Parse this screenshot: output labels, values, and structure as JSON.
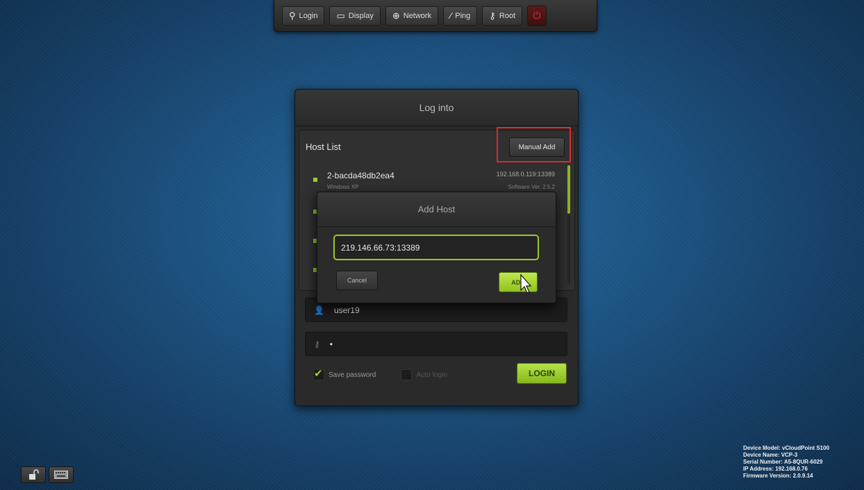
{
  "toolbar": {
    "login_label": "Login",
    "display_label": "Display",
    "network_label": "Network",
    "ping_label": "Ping",
    "root_label": "Root"
  },
  "login_panel": {
    "title": "Log into",
    "host_list_label": "Host List",
    "manual_add_label": "Manual Add",
    "hosts": [
      {
        "name": "2-bacda48db2ea4",
        "os": "Windows XP",
        "ip": "192.168.0.119:13389",
        "version": "Software Ver. 2.5.2"
      }
    ],
    "username": "user19",
    "password_mask": "•",
    "save_password_label": "Save password",
    "save_password_checked": true,
    "auto_login_label": "Auto login",
    "auto_login_checked": false,
    "login_button": "LOGIN"
  },
  "add_host_dialog": {
    "title": "Add Host",
    "address_value": "219.146.66.73:13389",
    "cancel_label": "Cancel",
    "add_label": "ADD"
  },
  "device_info": [
    "Device Model: vCloudPoint S100",
    "Device Name: VCP-3",
    "Serial Number: A5-8QUR-6029",
    "IP Address: 192.168.0.76",
    "Firmware Version: 2.0.9.14"
  ],
  "colors": {
    "accent_green": "#9cc82a",
    "highlight_red": "#e02a2a",
    "power_red": "#e53030"
  }
}
